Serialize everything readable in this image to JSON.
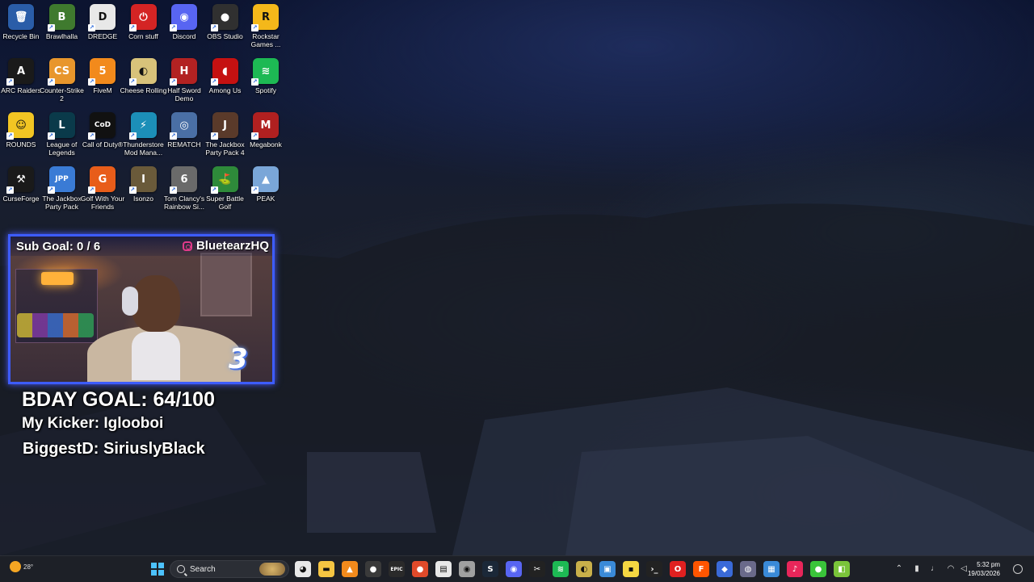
{
  "desktop": {
    "icons": [
      {
        "label": "Recycle Bin",
        "glyph": "🗑",
        "color": "#2a5da8"
      },
      {
        "label": "Brawlhalla",
        "glyph": "B",
        "color": "#3f7a2e"
      },
      {
        "label": "DREDGE",
        "glyph": "D",
        "color": "#e8e8e8"
      },
      {
        "label": "Corn stuff",
        "glyph": "⏻",
        "color": "#d42424"
      },
      {
        "label": "Discord",
        "glyph": "◉",
        "color": "#5865f2"
      },
      {
        "label": "OBS Studio",
        "glyph": "●",
        "color": "#303030"
      },
      {
        "label": "Rockstar Games ...",
        "glyph": "R",
        "color": "#f4b81a"
      },
      {
        "label": "ARC Raiders",
        "glyph": "A",
        "color": "#1a1a1a"
      },
      {
        "label": "Counter-Strike 2",
        "glyph": "CS",
        "color": "#e8962c"
      },
      {
        "label": "FiveM",
        "glyph": "5",
        "color": "#f28a1c"
      },
      {
        "label": "Cheese Rolling",
        "glyph": "◐",
        "color": "#d8c27a"
      },
      {
        "label": "Half Sword Demo",
        "glyph": "H",
        "color": "#b22222"
      },
      {
        "label": "Among Us",
        "glyph": "◖",
        "color": "#c51111"
      },
      {
        "label": "Spotify",
        "glyph": "≋",
        "color": "#1db954"
      },
      {
        "label": "ROUNDS",
        "glyph": "☺",
        "color": "#f2c523"
      },
      {
        "label": "League of Legends",
        "glyph": "L",
        "color": "#0a3a4a"
      },
      {
        "label": "Call of Duty®",
        "glyph": "CoD",
        "color": "#111111"
      },
      {
        "label": "Thunderstore Mod Mana...",
        "glyph": "⚡",
        "color": "#1c8fb8"
      },
      {
        "label": "REMATCH",
        "glyph": "◎",
        "color": "#4a6fa5"
      },
      {
        "label": "The Jackbox Party Pack 4",
        "glyph": "J",
        "color": "#5a3a2a"
      },
      {
        "label": "Megabonk",
        "glyph": "M",
        "color": "#b02020"
      },
      {
        "label": "CurseForge",
        "glyph": "⚒",
        "color": "#1a1a1a"
      },
      {
        "label": "The Jackbox Party Pack",
        "glyph": "JPP",
        "color": "#3a7bd5"
      },
      {
        "label": "Golf With Your Friends",
        "glyph": "G",
        "color": "#e85d1a"
      },
      {
        "label": "Isonzo",
        "glyph": "I",
        "color": "#6a5a3a"
      },
      {
        "label": "Tom Clancy's Rainbow Si...",
        "glyph": "6",
        "color": "#6a6a6a"
      },
      {
        "label": "Super Battle Golf",
        "glyph": "⛳",
        "color": "#2e8a3a"
      },
      {
        "label": "PEAK",
        "glyph": "▲",
        "color": "#7aa6d8"
      }
    ]
  },
  "stream_overlay": {
    "sub_goal": "Sub Goal:  0 / 6",
    "handle": "BluetearzHQ",
    "bday_goal": "BDAY GOAL: 64/100",
    "kicker": "My Kicker: Iglooboi",
    "biggest": "BiggestD: SiriuslyBlack"
  },
  "taskbar": {
    "weather": "28°",
    "search_placeholder": "Search",
    "time": "5:32 pm",
    "date": "19/03/2026",
    "pinned": [
      {
        "name": "chrome",
        "color": "#e8e8e8",
        "glyph": "◕"
      },
      {
        "name": "file-explorer",
        "color": "#f5c542",
        "glyph": "▬"
      },
      {
        "name": "vlc",
        "color": "#f28a1c",
        "glyph": "▲"
      },
      {
        "name": "obs",
        "color": "#3a3a3a",
        "glyph": "●"
      },
      {
        "name": "epic-games",
        "color": "#2a2a2a",
        "glyph": "EPIC"
      },
      {
        "name": "ea-app",
        "color": "#e04a2a",
        "glyph": "●"
      },
      {
        "name": "notepad-app",
        "color": "#e8e8e8",
        "glyph": "▤"
      },
      {
        "name": "browser-app",
        "color": "#a0a0a0",
        "glyph": "◉"
      },
      {
        "name": "steam",
        "color": "#1b2838",
        "glyph": "S"
      },
      {
        "name": "discord",
        "color": "#5865f2",
        "glyph": "◉"
      },
      {
        "name": "capcut",
        "color": "#222222",
        "glyph": "✂"
      },
      {
        "name": "spotify",
        "color": "#1db954",
        "glyph": "≋"
      },
      {
        "name": "game-app",
        "color": "#c9b04a",
        "glyph": "◐"
      },
      {
        "name": "photos",
        "color": "#3a8ad8",
        "glyph": "▣"
      },
      {
        "name": "sticky-notes",
        "color": "#f5d742",
        "glyph": "▪"
      },
      {
        "name": "terminal",
        "color": "#222222",
        "glyph": "›_"
      },
      {
        "name": "opera-gx",
        "color": "#e02020",
        "glyph": "O"
      },
      {
        "name": "faceit",
        "color": "#ff5500",
        "glyph": "F"
      },
      {
        "name": "app-diamond",
        "color": "#3a6ad8",
        "glyph": "◆"
      },
      {
        "name": "app-circle",
        "color": "#6a6a8a",
        "glyph": "◍"
      },
      {
        "name": "media-app",
        "color": "#3a8ad8",
        "glyph": "▦"
      },
      {
        "name": "tiktok",
        "color": "#e8265a",
        "glyph": "♪"
      },
      {
        "name": "messaging-app",
        "color": "#3ac43a",
        "glyph": "●"
      },
      {
        "name": "game-launcher",
        "color": "#7ac43a",
        "glyph": "◧"
      }
    ]
  }
}
